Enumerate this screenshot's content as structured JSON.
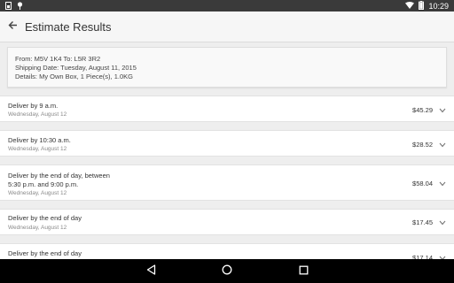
{
  "status_bar": {
    "time": "10:29",
    "left_icons": [
      "sim-card-icon",
      "notification-pin-icon"
    ],
    "right_icons": [
      "wifi-icon",
      "battery-icon"
    ]
  },
  "app_bar": {
    "title": "Estimate Results",
    "back_icon": "arrow-back-icon"
  },
  "summary": {
    "from_to": "From: M5V 1K4 To: L5R 3R2",
    "shipping_date": "Shipping Date: Tuesday, August 11, 2015",
    "details": "Details: My Own Box, 1 Piece(s), 1.0KG"
  },
  "results": [
    {
      "title_line1": "Deliver by 9 a.m.",
      "title_line2": "",
      "date": "Wednesday, August 12",
      "price": "$45.29"
    },
    {
      "title_line1": "Deliver by 10:30 a.m.",
      "title_line2": "",
      "date": "Wednesday, August 12",
      "price": "$28.52"
    },
    {
      "title_line1": "Deliver by the end of day, between",
      "title_line2": "5:30 p.m. and 9:00 p.m.",
      "date": "Wednesday, August 12",
      "price": "$58.04"
    },
    {
      "title_line1": "Deliver by the end of day",
      "title_line2": "",
      "date": "Wednesday, August 12",
      "price": "$17.45"
    },
    {
      "title_line1": "Deliver by the end of day",
      "title_line2": "",
      "date": "",
      "price": "$17.14"
    }
  ],
  "nav_bar": {
    "icons": [
      "back-triangle-icon",
      "home-circle-icon",
      "recents-square-icon"
    ]
  },
  "colors": {
    "status_bar": "#3a3a3a",
    "app_bar": "#f6f6f6",
    "background": "#eeeeee",
    "card": "#ffffff",
    "nav_bar": "#000000"
  }
}
